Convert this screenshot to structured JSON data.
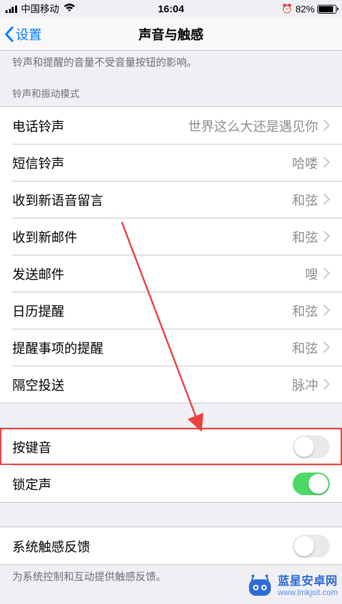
{
  "status": {
    "carrier": "中国移动",
    "time": "16:04",
    "battery": "82%"
  },
  "nav": {
    "back": "设置",
    "title": "声音与触感"
  },
  "note1": "铃声和提醒的音量不受音量按钮的影响。",
  "group1": {
    "header": "铃声和振动模式",
    "items": [
      {
        "label": "电话铃声",
        "value": "世界这么大还是遇见你"
      },
      {
        "label": "短信铃声",
        "value": "哈喽"
      },
      {
        "label": "收到新语音留言",
        "value": "和弦"
      },
      {
        "label": "收到新邮件",
        "value": "和弦"
      },
      {
        "label": "发送邮件",
        "value": "嗖"
      },
      {
        "label": "日历提醒",
        "value": "和弦"
      },
      {
        "label": "提醒事项的提醒",
        "value": "和弦"
      },
      {
        "label": "隔空投送",
        "value": "脉冲"
      }
    ]
  },
  "group2": [
    {
      "label": "按键音"
    },
    {
      "label": "锁定声"
    }
  ],
  "group3": {
    "items": [
      {
        "label": "系统触感反馈"
      }
    ],
    "footer": "为系统控制和互动提供触感反馈。"
  },
  "watermark": {
    "name": "蓝星安卓网",
    "url": "www.lmkjsit.com"
  }
}
